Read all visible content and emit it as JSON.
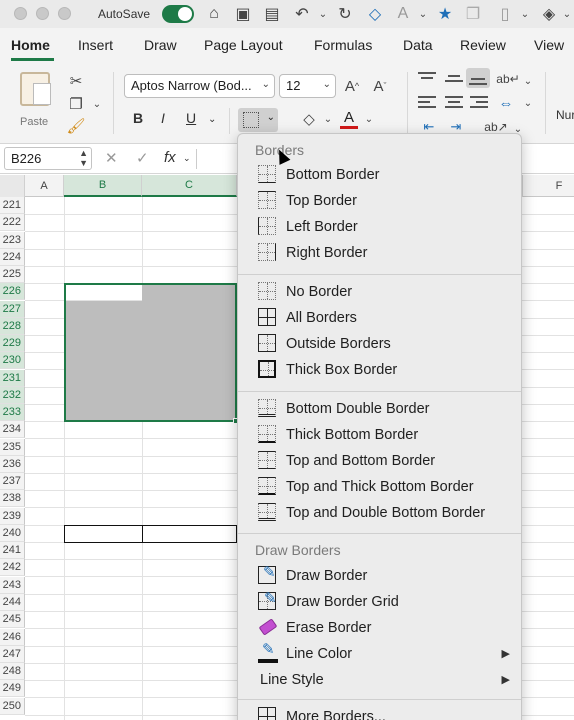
{
  "titlebar": {
    "autosave_label": "AutoSave"
  },
  "tabs": [
    {
      "label": "Home",
      "active": true
    },
    {
      "label": "Insert"
    },
    {
      "label": "Draw"
    },
    {
      "label": "Page Layout"
    },
    {
      "label": "Formulas"
    },
    {
      "label": "Data"
    },
    {
      "label": "Review"
    },
    {
      "label": "View"
    }
  ],
  "ribbon": {
    "paste_label": "Paste",
    "font_name": "Aptos Narrow (Bod...",
    "font_size": "12",
    "bold": "B",
    "italic": "I",
    "underline": "U",
    "number_group_partial": "Nur"
  },
  "formula_bar": {
    "name_box": "B226",
    "fx": "fx"
  },
  "grid": {
    "columns": [
      "A",
      "B",
      "C",
      "F"
    ],
    "selected_columns": [
      "B",
      "C"
    ],
    "rows": [
      "221",
      "222",
      "223",
      "224",
      "225",
      "226",
      "227",
      "228",
      "229",
      "230",
      "231",
      "232",
      "233",
      "234",
      "235",
      "236",
      "237",
      "238",
      "239",
      "240",
      "241",
      "242",
      "243",
      "244",
      "245",
      "246",
      "247",
      "248",
      "249",
      "250"
    ],
    "selected_rows": [
      "226",
      "227",
      "228",
      "229",
      "230",
      "231",
      "232",
      "233"
    ]
  },
  "menu": {
    "sections": [
      {
        "label": "Borders",
        "items": [
          {
            "label": "Bottom Border",
            "icon": "bottom-border-icon"
          },
          {
            "label": "Top Border",
            "icon": "top-border-icon"
          },
          {
            "label": "Left Border",
            "icon": "left-border-icon"
          },
          {
            "label": "Right Border",
            "icon": "right-border-icon"
          }
        ]
      },
      {
        "items": [
          {
            "label": "No Border",
            "icon": "no-border-icon"
          },
          {
            "label": "All Borders",
            "icon": "all-borders-icon"
          },
          {
            "label": "Outside Borders",
            "icon": "outside-borders-icon"
          },
          {
            "label": "Thick Box Border",
            "icon": "thick-box-border-icon"
          }
        ]
      },
      {
        "items": [
          {
            "label": "Bottom Double Border",
            "icon": "bottom-double-border-icon"
          },
          {
            "label": "Thick Bottom Border",
            "icon": "thick-bottom-border-icon"
          },
          {
            "label": "Top and Bottom Border",
            "icon": "top-bottom-border-icon"
          },
          {
            "label": "Top and Thick Bottom Border",
            "icon": "top-thick-bottom-border-icon"
          },
          {
            "label": "Top and Double Bottom Border",
            "icon": "top-double-bottom-border-icon"
          }
        ]
      },
      {
        "label": "Draw Borders",
        "items": [
          {
            "label": "Draw Border",
            "icon": "draw-border-icon"
          },
          {
            "label": "Draw Border Grid",
            "icon": "draw-border-grid-icon"
          },
          {
            "label": "Erase Border",
            "icon": "eraser-icon"
          },
          {
            "label": "Line Color",
            "icon": "line-color-icon",
            "submenu": true
          },
          {
            "label": "Line Style",
            "submenu": true
          }
        ]
      },
      {
        "items": [
          {
            "label": "More Borders...",
            "icon": "more-borders-icon"
          }
        ]
      }
    ]
  },
  "colors": {
    "accent_green": "#1e7a47",
    "font_color_red": "#d21a1a",
    "eraser_pink": "#c24fd0",
    "pen_blue": "#1f6fb8"
  }
}
